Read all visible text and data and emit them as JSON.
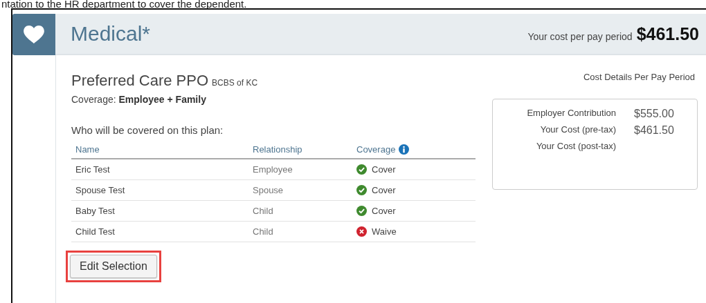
{
  "intro_text": "ntation to the HR department to cover the dependent.",
  "section": {
    "title": "Medical*",
    "cost_label": "Your cost per pay period",
    "cost_value": "$461.50"
  },
  "plan": {
    "name": "Preferred Care PPO",
    "carrier": "BCBS of KC",
    "coverage_label": "Coverage:",
    "coverage_value": "Employee + Family"
  },
  "covered_heading": "Who will be covered on this plan:",
  "table": {
    "columns": [
      "Name",
      "Relationship",
      "Coverage"
    ],
    "rows": [
      {
        "name": "Eric Test",
        "relationship": "Employee",
        "status": {
          "kind": "cover",
          "label": "Cover"
        }
      },
      {
        "name": "Spouse Test",
        "relationship": "Spouse",
        "status": {
          "kind": "cover",
          "label": "Cover"
        }
      },
      {
        "name": "Baby Test",
        "relationship": "Child",
        "status": {
          "kind": "cover",
          "label": "Cover"
        }
      },
      {
        "name": "Child Test",
        "relationship": "Child",
        "status": {
          "kind": "waive",
          "label": "Waive"
        }
      }
    ]
  },
  "edit_button": {
    "label": "Edit Selection",
    "highlighted": true
  },
  "cost_details": {
    "title": "Cost Details Per Pay Period",
    "lines": [
      {
        "label": "Employer Contribution",
        "value": "$555.00"
      },
      {
        "label": "Your Cost (pre-tax)",
        "value": "$461.50"
      },
      {
        "label": "Your Cost (post-tax)"
      }
    ]
  }
}
